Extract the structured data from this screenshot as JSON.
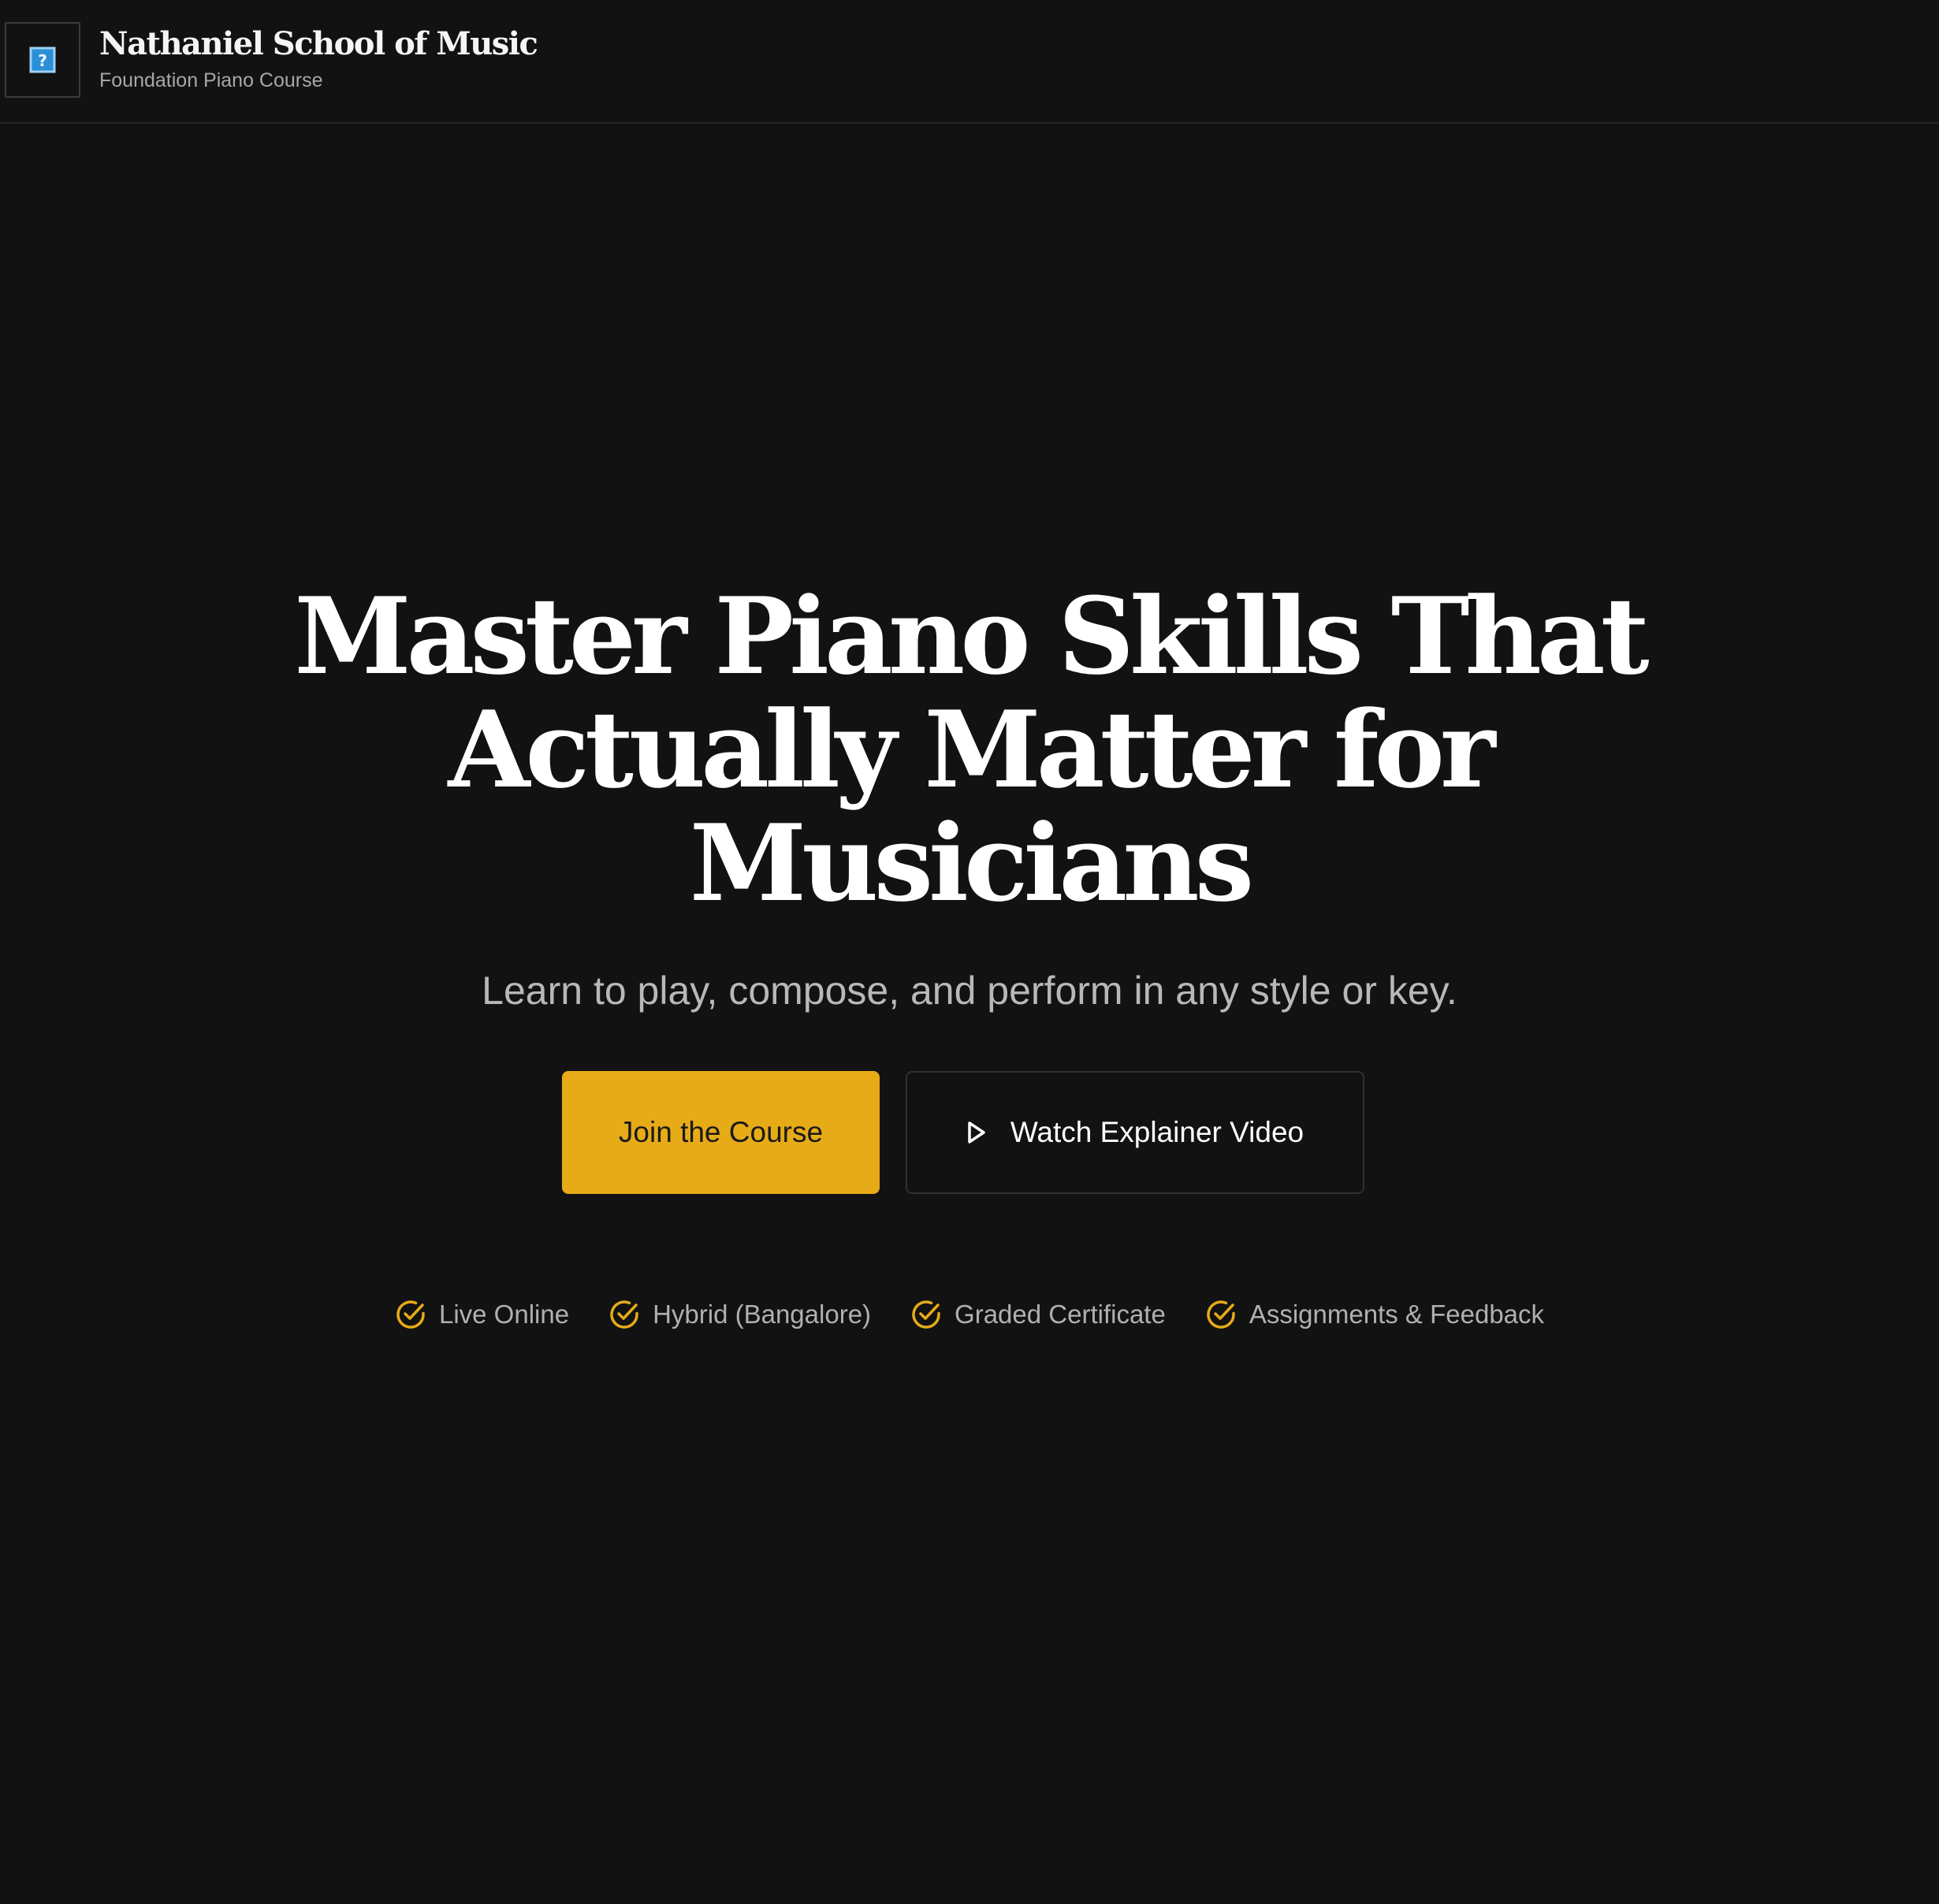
{
  "header": {
    "logo_icon": "broken-image-icon",
    "brand_name": "Nathaniel School of Music",
    "brand_subtitle": "Foundation Piano Course"
  },
  "hero": {
    "title_lines": [
      "Master Piano Skills That",
      "Actually Matter for",
      "Musicians"
    ],
    "subtitle": "Learn to play, compose, and perform in any style or key.",
    "primary_button": "Join the Course",
    "secondary_button": "Watch Explainer Video",
    "secondary_button_icon": "play-icon"
  },
  "features": [
    {
      "label": "Live Online",
      "icon": "check-circle-icon"
    },
    {
      "label": "Hybrid (Bangalore)",
      "icon": "check-circle-icon"
    },
    {
      "label": "Graded Certificate",
      "icon": "check-circle-icon"
    },
    {
      "label": "Assignments & Feedback",
      "icon": "check-circle-icon"
    }
  ],
  "colors": {
    "background": "#121212",
    "accent": "#e6ab17",
    "text": "#ffffff",
    "muted_text": "#b0b0b0"
  }
}
